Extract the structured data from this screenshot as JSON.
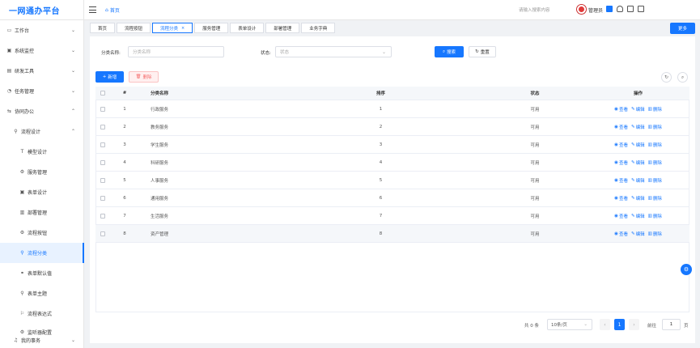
{
  "app": {
    "title": "一网通办平台"
  },
  "header": {
    "home_label": "首页",
    "search_placeholder": "请输入搜索内容",
    "user_name": "管理员"
  },
  "sidebar": {
    "items": [
      {
        "label": "工作台",
        "icon": "monitor-icon",
        "arrow": "⌄"
      },
      {
        "label": "系统监控",
        "icon": "monitor-icon",
        "arrow": "⌄"
      },
      {
        "label": "研发工具",
        "icon": "tool-icon",
        "arrow": "⌄"
      },
      {
        "label": "任务管理",
        "icon": "task-icon",
        "arrow": "⌄"
      },
      {
        "label": "协同办公",
        "icon": "cooperate-icon",
        "arrow": "⌃"
      },
      {
        "label": "流程设计",
        "icon": "flow-icon",
        "arrow": "⌃"
      },
      {
        "label": "模型设计",
        "icon": "model-icon"
      },
      {
        "label": "服务管理",
        "icon": "gear-icon"
      },
      {
        "label": "表单设计",
        "icon": "form-icon"
      },
      {
        "label": "部署管理",
        "icon": "deploy-icon"
      },
      {
        "label": "流程按钮",
        "icon": "gear-icon"
      },
      {
        "label": "流程分类",
        "icon": "category-icon"
      },
      {
        "label": "表单默认值",
        "icon": "link-icon"
      },
      {
        "label": "表单主题",
        "icon": "theme-icon"
      },
      {
        "label": "流程表达式",
        "icon": "flag-icon"
      },
      {
        "label": "监听器配置",
        "icon": "gear-icon"
      },
      {
        "label": "我的事务",
        "icon": "bell-icon",
        "arrow": "⌄"
      }
    ]
  },
  "tabs": [
    {
      "label": "首页"
    },
    {
      "label": "流程按钮"
    },
    {
      "label": "流程分类",
      "close": "×"
    },
    {
      "label": "服务管理"
    },
    {
      "label": "表单设计"
    },
    {
      "label": "部署管理"
    },
    {
      "label": "业务字典"
    }
  ],
  "more_label": "更多",
  "filters": {
    "name_label": "分类名称:",
    "name_placeholder": "分类名称",
    "status_label": "状态:",
    "status_placeholder": "状态",
    "search_button": "搜索",
    "reset_button": "重置"
  },
  "actions": {
    "add_button": "新增",
    "delete_button": "删除"
  },
  "table": {
    "columns": [
      "#",
      "分类名称",
      "排序",
      "状态",
      "操作"
    ],
    "op_labels": {
      "view": "查看",
      "edit": "编辑",
      "delete": "删除"
    },
    "rows": [
      {
        "idx": "1",
        "name": "行政服务",
        "sort": "1",
        "status": "可用"
      },
      {
        "idx": "2",
        "name": "教务服务",
        "sort": "2",
        "status": "可用"
      },
      {
        "idx": "3",
        "name": "学生服务",
        "sort": "3",
        "status": "可用"
      },
      {
        "idx": "4",
        "name": "科研服务",
        "sort": "4",
        "status": "可用"
      },
      {
        "idx": "5",
        "name": "人事服务",
        "sort": "5",
        "status": "可用"
      },
      {
        "idx": "6",
        "name": "通用服务",
        "sort": "6",
        "status": "可用"
      },
      {
        "idx": "7",
        "name": "生活服务",
        "sort": "7",
        "status": "可用"
      },
      {
        "idx": "8",
        "name": "资产管理",
        "sort": "8",
        "status": "可用"
      }
    ]
  },
  "pagination": {
    "total": "共 0 条",
    "page_size": "10条/页",
    "prev": "‹",
    "current": "1",
    "next": "›",
    "goto_label": "前往",
    "goto_value": "1",
    "unit": "页"
  },
  "colors": {
    "primary": "#1677ff",
    "danger": "#f56c6c"
  }
}
